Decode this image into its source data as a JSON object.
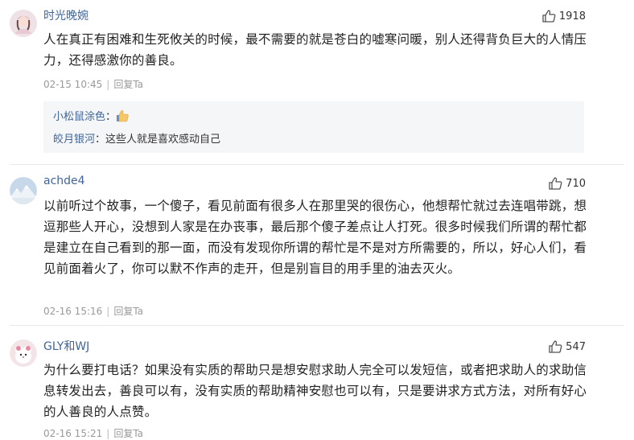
{
  "comments": [
    {
      "username": "时光晚婉",
      "likes": "1918",
      "content": "人在真正有困难和生死攸关的时候，最不需要的就是苍白的嘘寒问暖，别人还得背负巨大的人情压力，还得感激你的善良。",
      "time": "02-15 10:45",
      "reply_label": "回复Ta",
      "replies": [
        {
          "user": "小松鼠涂色",
          "colon": "：",
          "text": "",
          "emoji": "thumbs-up-emoji"
        },
        {
          "user": "皎月银河",
          "colon": "：",
          "text": "这些人就是喜欢感动自己"
        }
      ]
    },
    {
      "username": "achde4",
      "likes": "710",
      "content": "以前听过个故事，一个傻子，看见前面有很多人在那里哭的很伤心，他想帮忙就过去连唱带跳，想逗那些人开心，没想到人家是在办丧事，最后那个傻子差点让人打死。很多时候我们所谓的帮忙都是建立在自己看到的那一面，而没有发现你所谓的帮忙是不是对方所需要的，所以，好心人们，看见前面着火了，你可以默不作声的走开，但是别盲目的用手里的油去灭火。",
      "time": "02-16 15:16",
      "reply_label": "回复Ta"
    },
    {
      "username": "GLY和WJ",
      "likes": "547",
      "content": "为什么要打电话？如果没有实质的帮助只是想安慰求助人完全可以发短信，或者把求助人的求助信息转发出去，善良可以有，没有实质的帮助精神安慰也可以有，只是要讲求方式方法，对所有好心的人善良的人点赞。",
      "time": "02-16 15:21",
      "reply_label": "回复Ta"
    }
  ],
  "colors": {
    "username": "#406599",
    "meta": "#999999",
    "reply_bg": "#f5f6f8"
  },
  "icons": [
    "thumbs-up-icon",
    "avatar"
  ]
}
